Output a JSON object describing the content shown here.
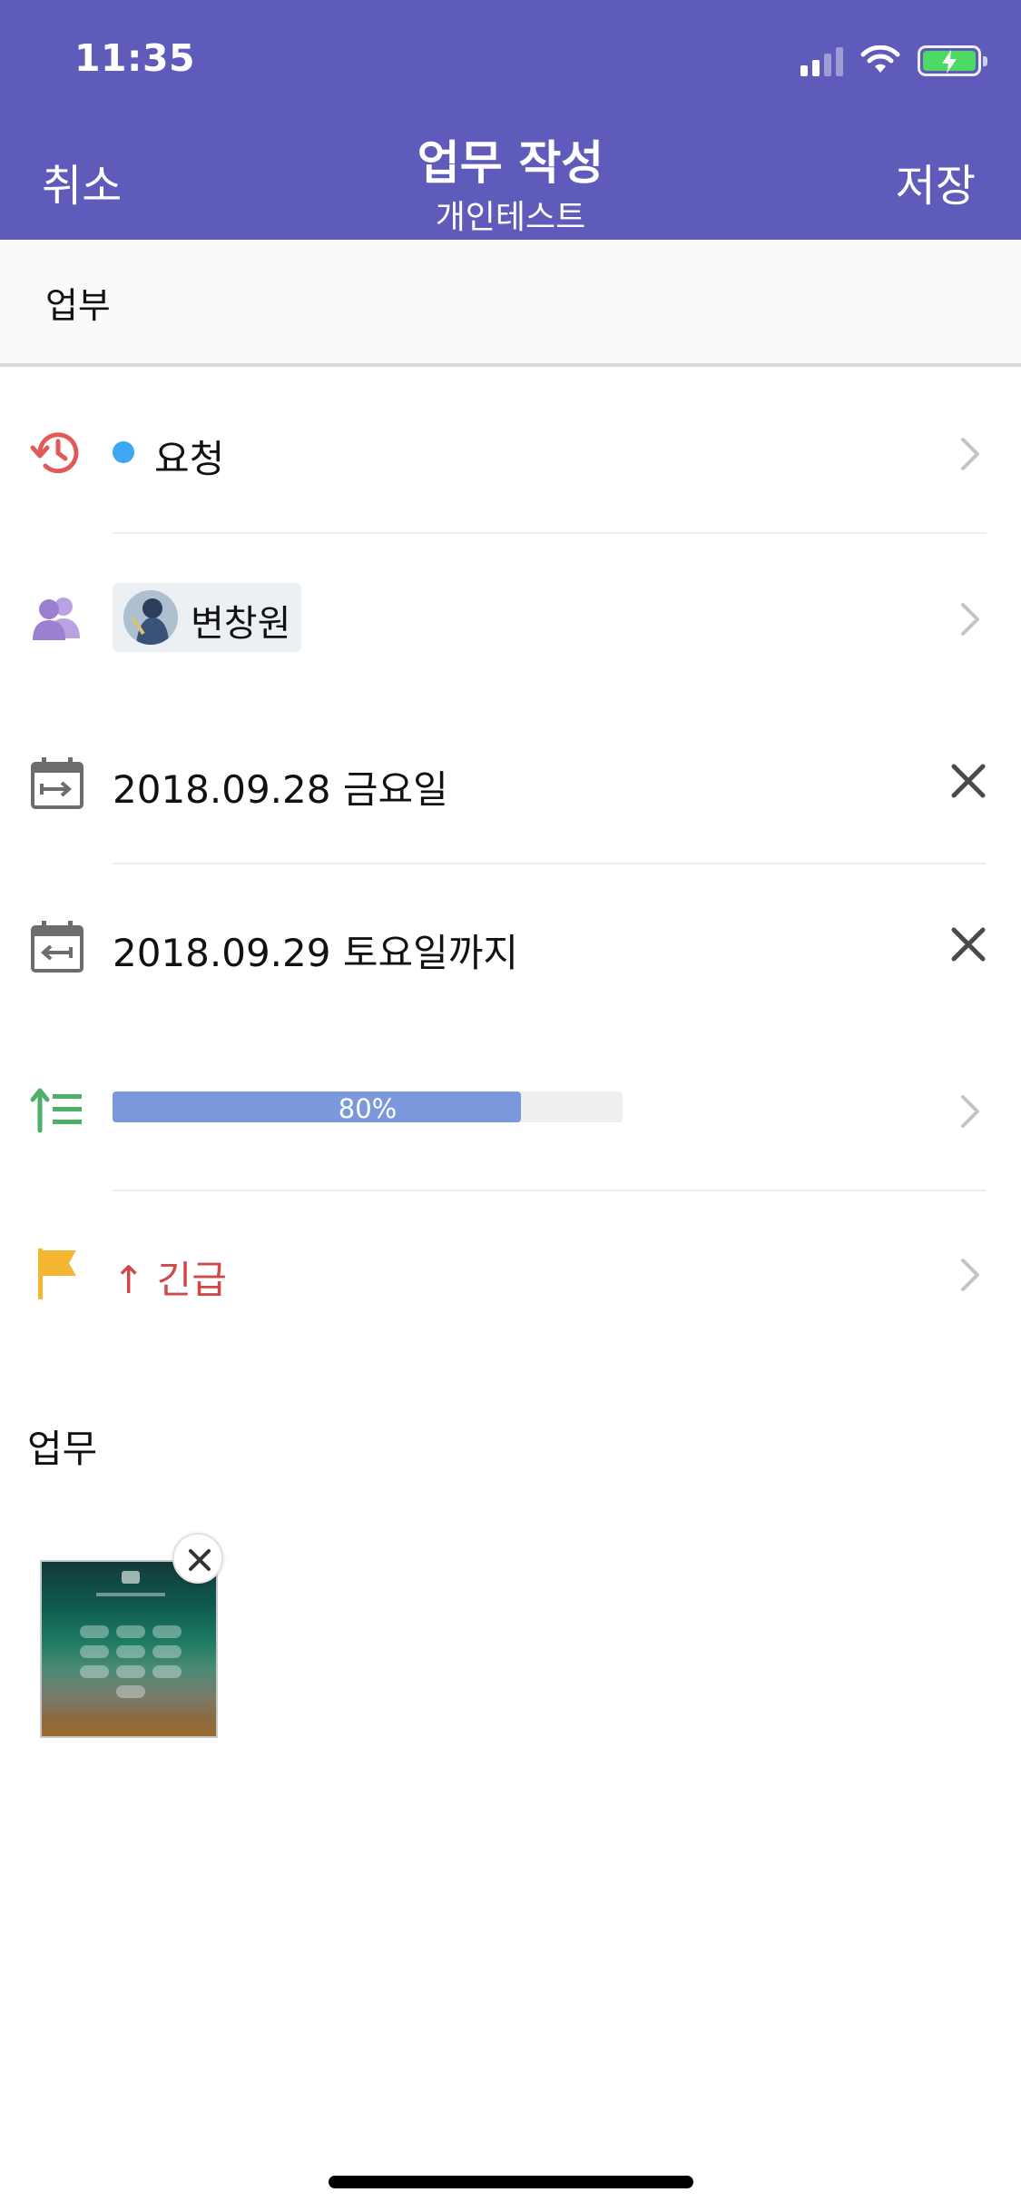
{
  "status_bar": {
    "time": "11:35"
  },
  "nav": {
    "cancel_label": "취소",
    "title": "업무 작성",
    "subtitle": "개인테스트",
    "save_label": "저장"
  },
  "title_input": {
    "value": "업부"
  },
  "rows": {
    "status": {
      "label": "요청",
      "icon": "history-icon",
      "dot_color": "#3da7f0"
    },
    "assignee": {
      "name": "변창원",
      "icon": "people-icon"
    },
    "start_date": {
      "label": "2018.09.28 금요일",
      "icon": "calendar-start-icon"
    },
    "due_date": {
      "label": "2018.09.29 토요일까지",
      "icon": "calendar-end-icon"
    },
    "progress": {
      "label": "80%",
      "value": 0.8,
      "icon": "progress-list-icon"
    },
    "priority": {
      "arrow": "↑",
      "label": "긴급",
      "icon": "flag-icon",
      "color": "#d14848"
    }
  },
  "section": {
    "label": "업무"
  },
  "colors": {
    "header": "#5f5bbb",
    "status_dot": "#3da7f0",
    "progress": "#7a98db",
    "urgent": "#d14848",
    "flag": "#f5b731",
    "people": "#9b7fd0",
    "history": "#e05a5a",
    "progress_icon": "#4caf6a"
  }
}
